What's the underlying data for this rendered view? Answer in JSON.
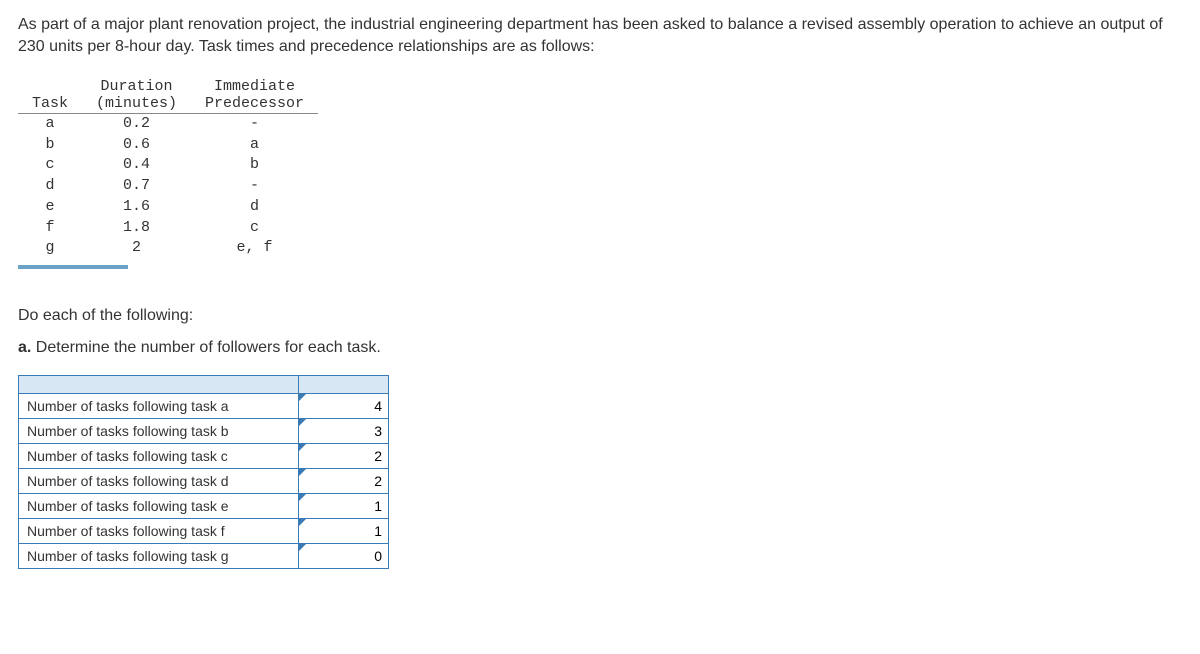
{
  "intro": "As part of a major plant renovation project, the industrial engineering department has been asked to balance a revised assembly operation to achieve an output of 230 units per 8-hour day. Task times and precedence relationships are as follows:",
  "task_table": {
    "headers": {
      "task": "Task",
      "duration_line1": "Duration",
      "duration_line2": "(minutes)",
      "pred_line1": "Immediate",
      "pred_line2": "Predecessor"
    },
    "rows": [
      {
        "task": "a",
        "duration": "0.2",
        "pred": "-"
      },
      {
        "task": "b",
        "duration": "0.6",
        "pred": "a"
      },
      {
        "task": "c",
        "duration": "0.4",
        "pred": "b"
      },
      {
        "task": "d",
        "duration": "0.7",
        "pred": "-"
      },
      {
        "task": "e",
        "duration": "1.6",
        "pred": "d"
      },
      {
        "task": "f",
        "duration": "1.8",
        "pred": "c"
      },
      {
        "task": "g",
        "duration": "2",
        "pred": "e, f"
      }
    ]
  },
  "subhead": "Do each of the following:",
  "question_prefix": "a.",
  "question_text": " Determine the number of followers for each task.",
  "followers": {
    "rows": [
      {
        "label": "Number of tasks following task a",
        "value": "4"
      },
      {
        "label": "Number of tasks following task b",
        "value": "3"
      },
      {
        "label": "Number of tasks following task c",
        "value": "2"
      },
      {
        "label": "Number of tasks following task d",
        "value": "2"
      },
      {
        "label": "Number of tasks following task e",
        "value": "1"
      },
      {
        "label": "Number of tasks following task f",
        "value": "1"
      },
      {
        "label": "Number of tasks following task g",
        "value": "0"
      }
    ]
  }
}
